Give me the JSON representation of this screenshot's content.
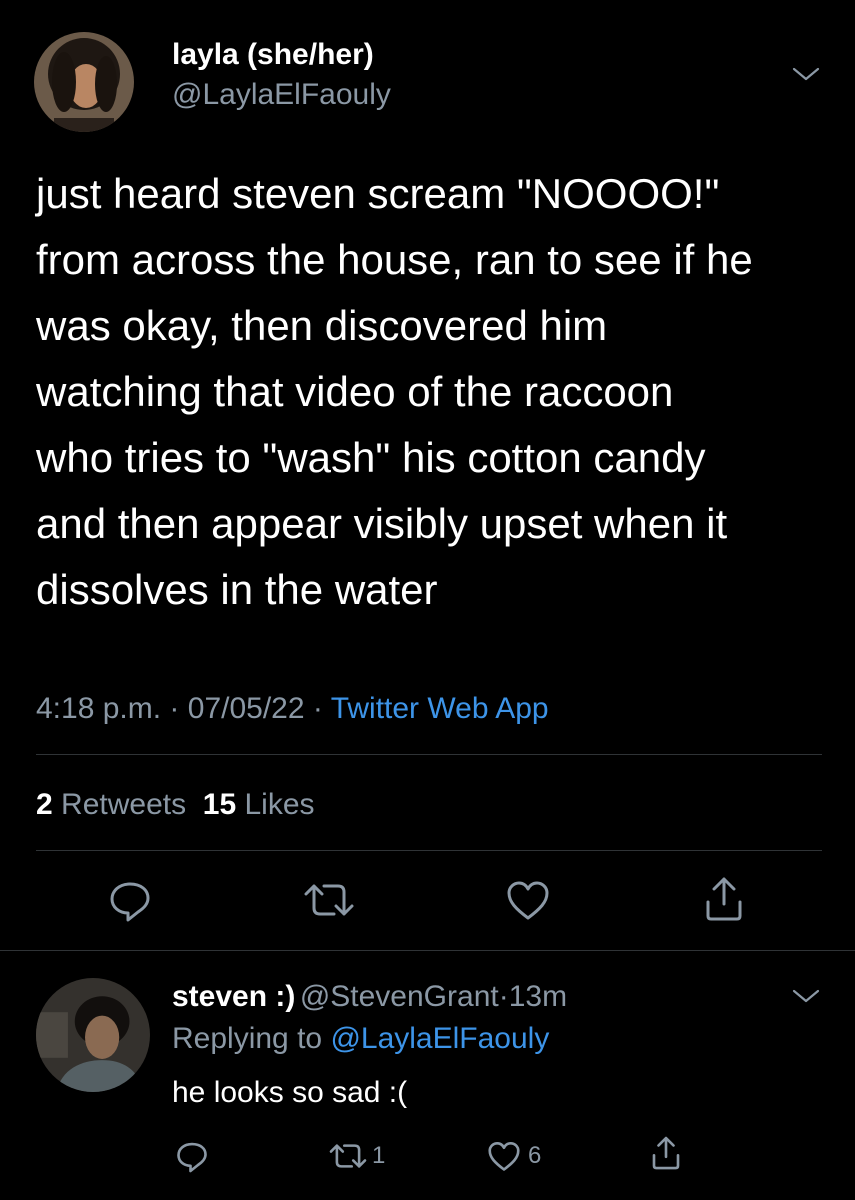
{
  "tweet": {
    "author_name": "layla (she/her)",
    "author_handle": "@LaylaElFaouly",
    "text_lines": [
      "just heard steven scream \"NOOOO!\"",
      "from across the house, ran to see if he",
      "was okay, then discovered him",
      "watching that video of the raccoon",
      "who tries to \"wash\" his cotton candy",
      "and then appear visibly upset when it",
      "dissolves in the water"
    ],
    "time": "4:18 p.m.",
    "date": "07/05/22",
    "separator": "·",
    "source": "Twitter Web App",
    "retweets_count": "2",
    "retweets_label": "Retweets",
    "likes_count": "15",
    "likes_label": "Likes",
    "actions": [
      "reply-icon",
      "retweet-icon",
      "like-icon",
      "share-icon"
    ]
  },
  "reply": {
    "author_name": "steven :)",
    "author_handle": "@StevenGrant",
    "separator": "·",
    "age": "13m",
    "replying_prefix": "Replying to",
    "replying_mention": "@LaylaElFaouly",
    "text": "he looks so sad :(",
    "retweet_count": "1",
    "like_count": "6"
  },
  "colors": {
    "background": "#000000",
    "text": "#ffffff",
    "secondary": "#8b98a5",
    "link": "#3d94e8",
    "divider": "#2f3336"
  }
}
